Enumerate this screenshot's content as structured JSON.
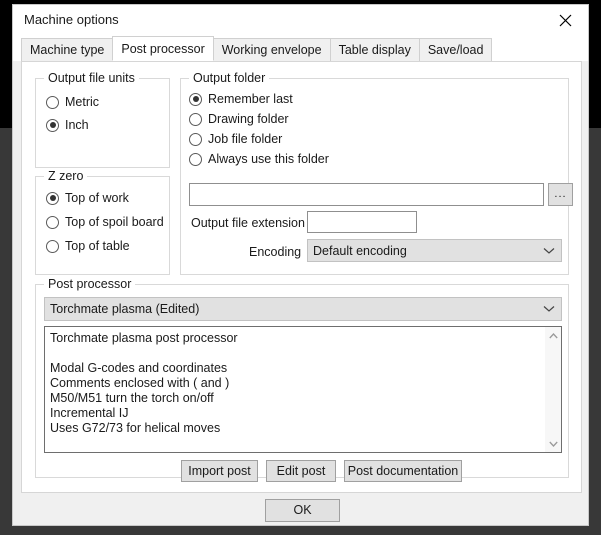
{
  "window": {
    "title": "Machine options",
    "close_icon": "close-icon"
  },
  "tabs": [
    {
      "label": "Machine type",
      "active": false
    },
    {
      "label": "Post processor",
      "active": true
    },
    {
      "label": "Working envelope",
      "active": false
    },
    {
      "label": "Table display",
      "active": false
    },
    {
      "label": "Save/load",
      "active": false
    }
  ],
  "output_file_units": {
    "legend": "Output file units",
    "options": [
      {
        "label": "Metric",
        "selected": false
      },
      {
        "label": "Inch",
        "selected": true
      }
    ]
  },
  "z_zero": {
    "legend": "Z zero",
    "options": [
      {
        "label": "Top of work",
        "selected": true
      },
      {
        "label": "Top of spoil board",
        "selected": false
      },
      {
        "label": "Top of table",
        "selected": false
      }
    ]
  },
  "output_folder": {
    "legend": "Output folder",
    "options": [
      {
        "label": "Remember last",
        "selected": true
      },
      {
        "label": "Drawing folder",
        "selected": false
      },
      {
        "label": "Job file folder",
        "selected": false
      },
      {
        "label": "Always use this folder",
        "selected": false
      }
    ],
    "folder_path": {
      "value": "",
      "placeholder": ""
    },
    "browse_label": "...",
    "extension_label": "Output file extension",
    "extension_value": {
      "value": "",
      "placeholder": ""
    },
    "encoding_label": "Encoding",
    "encoding_value": "Default encoding"
  },
  "post_processor": {
    "legend": "Post processor",
    "selected": "Torchmate plasma (Edited)",
    "description": "Torchmate plasma post processor\n\nModal G-codes and coordinates\nComments enclosed with ( and )\nM50/M51 turn the torch on/off\nIncremental IJ\nUses G72/73 for helical moves",
    "buttons": {
      "import": "Import post",
      "edit": "Edit post",
      "documentation": "Post documentation"
    }
  },
  "footer": {
    "ok_label": "OK"
  },
  "colors": {
    "dialog_bg": "#f0f0f0",
    "page_bg": "#ffffff",
    "button_face": "#e1e1e1",
    "combo_face": "#e1e1e1",
    "text": "#1a1a1a",
    "group_border": "#d9d9d9",
    "backdrop_dark": "#383838",
    "backdrop_black": "#000000"
  }
}
